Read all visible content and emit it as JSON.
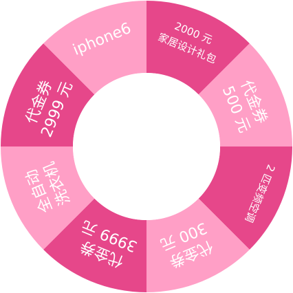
{
  "wheel": {
    "segments": [
      {
        "lines": [
          "2000 元",
          "家居设计礼包"
        ],
        "color": "#e6478a",
        "text_size": "small"
      },
      {
        "lines": [
          "代金券",
          "500 元"
        ],
        "color": "#ff9fc6",
        "text_size": "large"
      },
      {
        "lines": [
          "2 匹变频空调"
        ],
        "color": "#e6478a",
        "text_size": "small"
      },
      {
        "lines": [
          "代金券",
          "300 元"
        ],
        "color": "#ff9fc6",
        "text_size": "large"
      },
      {
        "lines": [
          "代金券",
          "3999 元"
        ],
        "color": "#e6478a",
        "text_size": "large"
      },
      {
        "lines": [
          "全自动",
          "洗衣机"
        ],
        "color": "#ff9fc6",
        "text_size": "large"
      },
      {
        "lines": [
          "代金券",
          "2999 元"
        ],
        "color": "#e6478a",
        "text_size": "large"
      },
      {
        "lines": [
          "iphone6"
        ],
        "color": "#ff9fc6",
        "text_size": "large"
      }
    ],
    "center_color": "#ffffff",
    "text_color": "#ffffff"
  }
}
